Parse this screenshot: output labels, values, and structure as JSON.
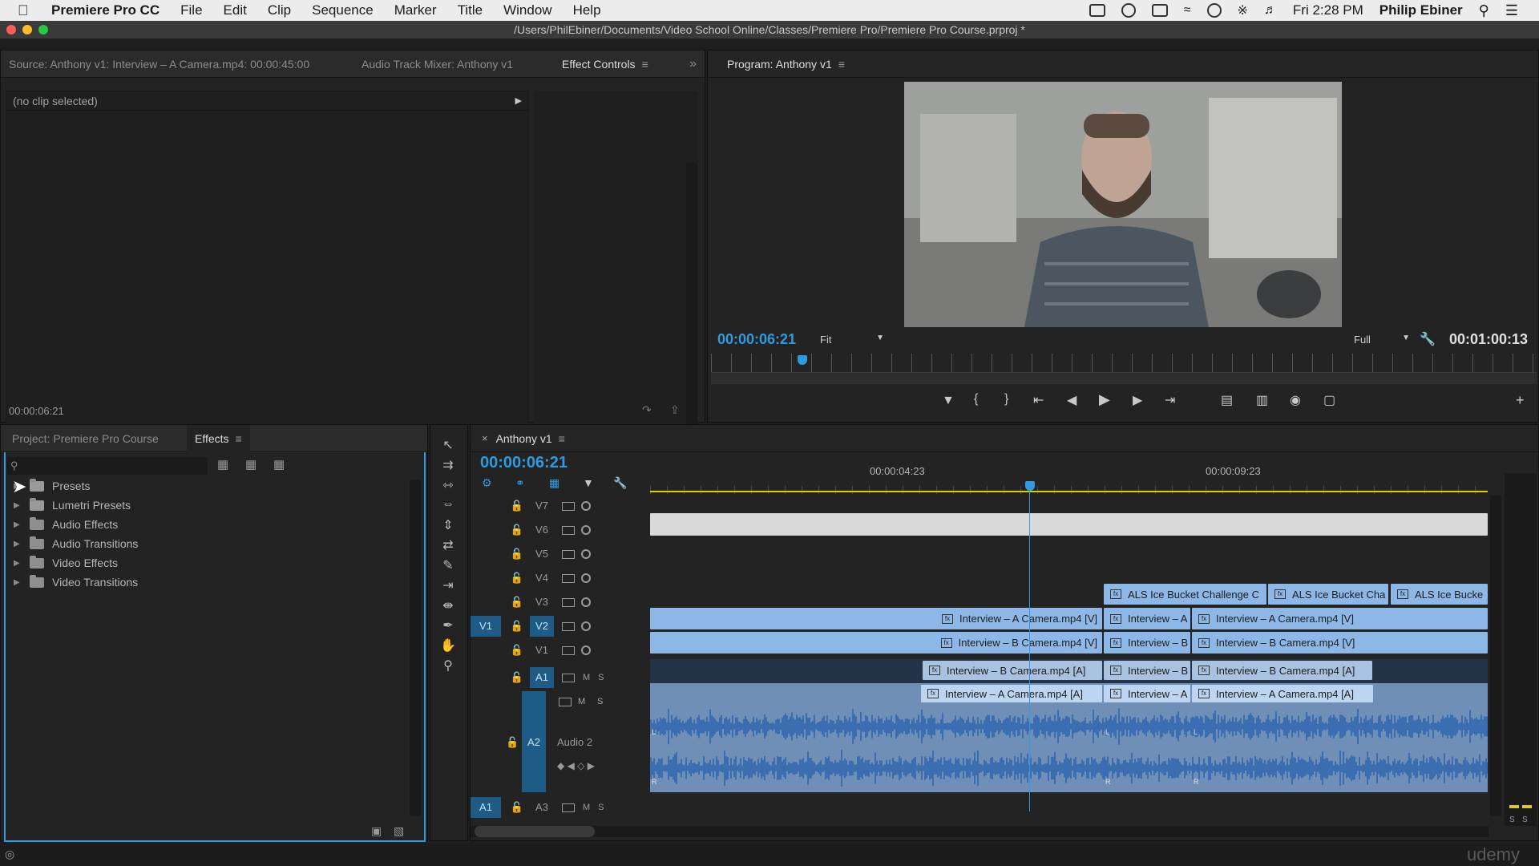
{
  "menubar": {
    "app_name": "Premiere Pro CC",
    "menus": [
      "File",
      "Edit",
      "Clip",
      "Sequence",
      "Marker",
      "Title",
      "Window",
      "Help"
    ],
    "clock": "Fri 2:28 PM",
    "user": "Philip Ebiner"
  },
  "window": {
    "title": "/Users/PhilEbiner/Documents/Video School Online/Classes/Premiere Pro/Premiere Pro Course.prproj *"
  },
  "source_panel": {
    "tabs": [
      "Source: Anthony v1: Interview – A Camera.mp4: 00:00:45:00",
      "Audio Track Mixer: Anthony v1",
      "Effect Controls"
    ],
    "active_tab": "Effect Controls",
    "no_clip_text": "(no clip selected)",
    "timecode": "00:00:06:21"
  },
  "program_panel": {
    "title": "Program: Anthony v1",
    "timecode": "00:00:06:21",
    "zoom": "Fit",
    "resolution": "Full",
    "duration": "00:01:00:13"
  },
  "project_panel": {
    "tabs": [
      "Project: Premiere Pro Course",
      "Effects"
    ],
    "active_tab": "Effects",
    "tree": [
      {
        "label": "Presets",
        "icon": "preset-folder-icon"
      },
      {
        "label": "Lumetri Presets",
        "icon": "preset-folder-icon"
      },
      {
        "label": "Audio Effects",
        "icon": "folder-icon"
      },
      {
        "label": "Audio Transitions",
        "icon": "folder-icon"
      },
      {
        "label": "Video Effects",
        "icon": "folder-icon"
      },
      {
        "label": "Video Transitions",
        "icon": "folder-icon"
      }
    ]
  },
  "timeline": {
    "sequence_name": "Anthony v1",
    "timecode": "00:00:06:21",
    "ruler_labels": [
      "00:00:04:23",
      "00:00:09:23"
    ],
    "tracks": {
      "video": [
        "V7",
        "V6",
        "V5",
        "V4",
        "V3",
        "V2",
        "V1"
      ],
      "audio": [
        "A1",
        "A2",
        "A3"
      ],
      "audio2_name": "Audio 2",
      "source_v": "V1",
      "source_a": "A1",
      "mute_label": "M",
      "solo_label": "S"
    },
    "clips": {
      "v3_1": "ALS Ice Bucket Challenge C",
      "v3_2": "ALS Ice Bucket Cha",
      "v3_3": "ALS Ice Bucke",
      "v2_1": "Interview – A Camera.mp4 [V]",
      "v2_2": "Interview – A",
      "v2_3": "Interview – A Camera.mp4 [V]",
      "v1_1": "Interview – B Camera.mp4 [V]",
      "v1_2": "Interview – B",
      "v1_3": "Interview – B Camera.mp4 [V]",
      "a1_1": "Interview – B Camera.mp4 [A]",
      "a1_2": "Interview – B",
      "a1_3": "Interview – B Camera.mp4 [A]",
      "a2_1": "Interview – A Camera.mp4 [A]",
      "a2_2": "Interview – A",
      "a2_3": "Interview – A Camera.mp4 [A]",
      "fx_label": "fx",
      "channel_l": "L",
      "channel_r": "R"
    }
  },
  "meter_labels": [
    "S",
    "S"
  ],
  "watermark": "udemy",
  "colors": {
    "timecode_blue": "#2f9ae0",
    "video_clip": "#8db7e6",
    "audio_clip": "#bcd6f2",
    "waveform": "#3a6eb0",
    "track_target": "#1e5b86"
  }
}
